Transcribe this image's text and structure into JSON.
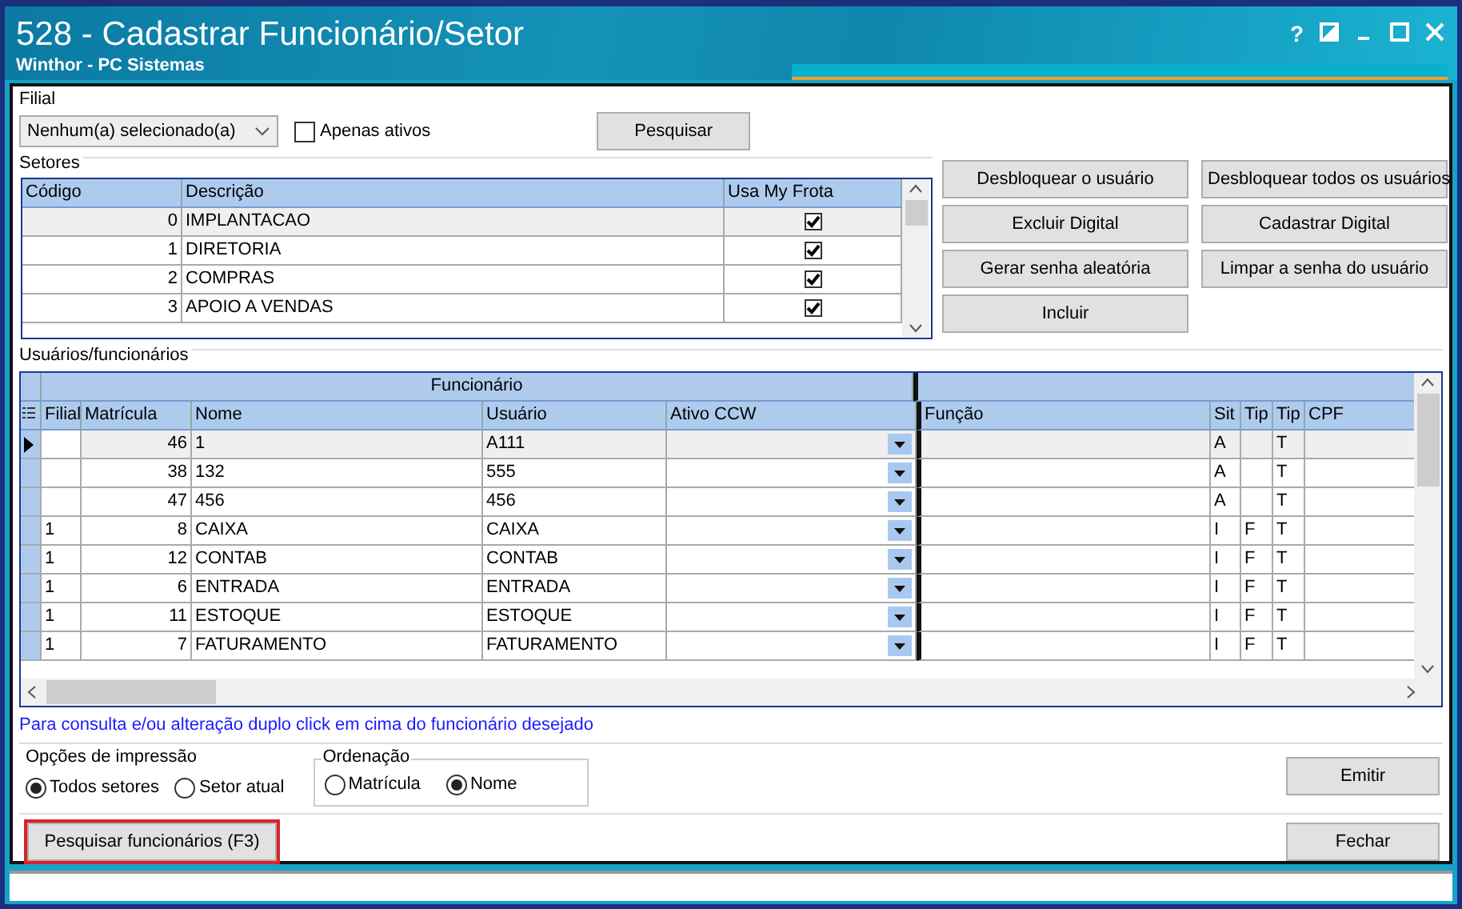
{
  "window": {
    "title": "528 - Cadastrar Funcionário/Setor",
    "subtitle": "Winthor - PC Sistemas",
    "help": "?"
  },
  "filial": {
    "label": "Filial",
    "value": "Nenhum(a) selecionado(a)"
  },
  "apenas_ativos": {
    "label": "Apenas ativos",
    "checked": false
  },
  "pesquisar_button": "Pesquisar",
  "setores": {
    "title": "Setores",
    "columns": [
      "Código",
      "Descrição",
      "Usa My Frota"
    ],
    "rows": [
      {
        "codigo": "0",
        "descricao": "IMPLANTACAO",
        "usa_my_frota": true,
        "selected": true
      },
      {
        "codigo": "1",
        "descricao": "DIRETORIA",
        "usa_my_frota": true,
        "selected": false
      },
      {
        "codigo": "2",
        "descricao": "COMPRAS",
        "usa_my_frota": true,
        "selected": false
      },
      {
        "codigo": "3",
        "descricao": "APOIO A VENDAS",
        "usa_my_frota": true,
        "selected": false
      }
    ]
  },
  "action_buttons": [
    "Desbloquear o usuário",
    "Desbloquear todos os usuários",
    "Excluir Digital",
    "Cadastrar Digital",
    "Gerar senha aleatória",
    "Limpar a senha do usuário",
    "Incluir"
  ],
  "usuarios": {
    "title": "Usuários/funcionários",
    "group_header": "Funcionário",
    "columns": [
      "Filial",
      "Matrícula",
      "Nome",
      "Usuário",
      "Ativo CCW",
      "Função",
      "Sit",
      "Tip",
      "Tip",
      "CPF"
    ],
    "rows": [
      {
        "matricula": "46",
        "nome": "1",
        "usuario": "A111",
        "sit": "A",
        "tip2": "T",
        "selected": true
      },
      {
        "matricula": "38",
        "nome": "132",
        "usuario": "555",
        "sit": "A",
        "tip2": "T",
        "selected": false
      },
      {
        "matricula": "47",
        "nome": "456",
        "usuario": "456",
        "sit": "A",
        "tip2": "T",
        "selected": false
      },
      {
        "filial": "1",
        "matricula": "8",
        "nome": "CAIXA",
        "usuario": "CAIXA",
        "sit": "I",
        "tip1": "F",
        "tip2": "T",
        "selected": false
      },
      {
        "filial": "1",
        "matricula": "12",
        "nome": "CONTAB",
        "usuario": "CONTAB",
        "sit": "I",
        "tip1": "F",
        "tip2": "T",
        "selected": false
      },
      {
        "filial": "1",
        "matricula": "6",
        "nome": "ENTRADA",
        "usuario": "ENTRADA",
        "sit": "I",
        "tip1": "F",
        "tip2": "T",
        "selected": false
      },
      {
        "filial": "1",
        "matricula": "11",
        "nome": "ESTOQUE",
        "usuario": "ESTOQUE",
        "sit": "I",
        "tip1": "F",
        "tip2": "T",
        "selected": false
      },
      {
        "filial": "1",
        "matricula": "7",
        "nome": "FATURAMENTO",
        "usuario": "FATURAMENTO",
        "sit": "I",
        "tip1": "F",
        "tip2": "T",
        "selected": false
      }
    ]
  },
  "hint": "Para consulta e/ou alteração duplo click em cima do funcionário desejado",
  "print_options": {
    "title": "Opções de impressão",
    "options": [
      {
        "label": "Todos setores",
        "selected": true
      },
      {
        "label": "Setor atual",
        "selected": false
      }
    ]
  },
  "ordering": {
    "title": "Ordenação",
    "options": [
      {
        "label": "Matrícula",
        "selected": false
      },
      {
        "label": "Nome",
        "selected": true
      }
    ]
  },
  "emitir_button": "Emitir",
  "search_employees_button": {
    "label": "Pesquisar funcionários (F3)",
    "highlighted": true
  },
  "fechar_button": "Fechar"
}
